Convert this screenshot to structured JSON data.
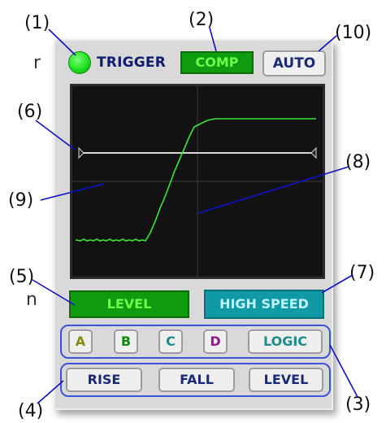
{
  "callouts": {
    "c1": "(1)",
    "c2": "(2)",
    "c3": "(3)",
    "c4": "(4)",
    "c5": "(5)",
    "c6": "(6)",
    "c7": "(7)",
    "c8": "(8)",
    "c9": "(9)",
    "c10": "(10)"
  },
  "edge_text": {
    "r": "r",
    "n": "n"
  },
  "panel": {
    "trigger_label": "TRIGGER",
    "comp_label": "COMP",
    "auto_label": "AUTO"
  },
  "modes": {
    "left_label": "LEVEL",
    "right_label": "HIGH SPEED"
  },
  "channels": [
    {
      "label": "A",
      "color": "#8a8a10"
    },
    {
      "label": "B",
      "color": "#0f8a0f"
    },
    {
      "label": "C",
      "color": "#1b8b8b"
    },
    {
      "label": "D",
      "color": "#8a1a8a"
    }
  ],
  "logic_label": "LOGIC",
  "logic_color": "#1b8b8b",
  "edges": {
    "rise": "RISE",
    "fall": "FALL",
    "level": "LEVEL"
  },
  "colors": {
    "trace": "#39e639",
    "trigger_line": "#d8d8d8",
    "callout_line": "#1010c8",
    "group_outline": "#3b55d8"
  }
}
